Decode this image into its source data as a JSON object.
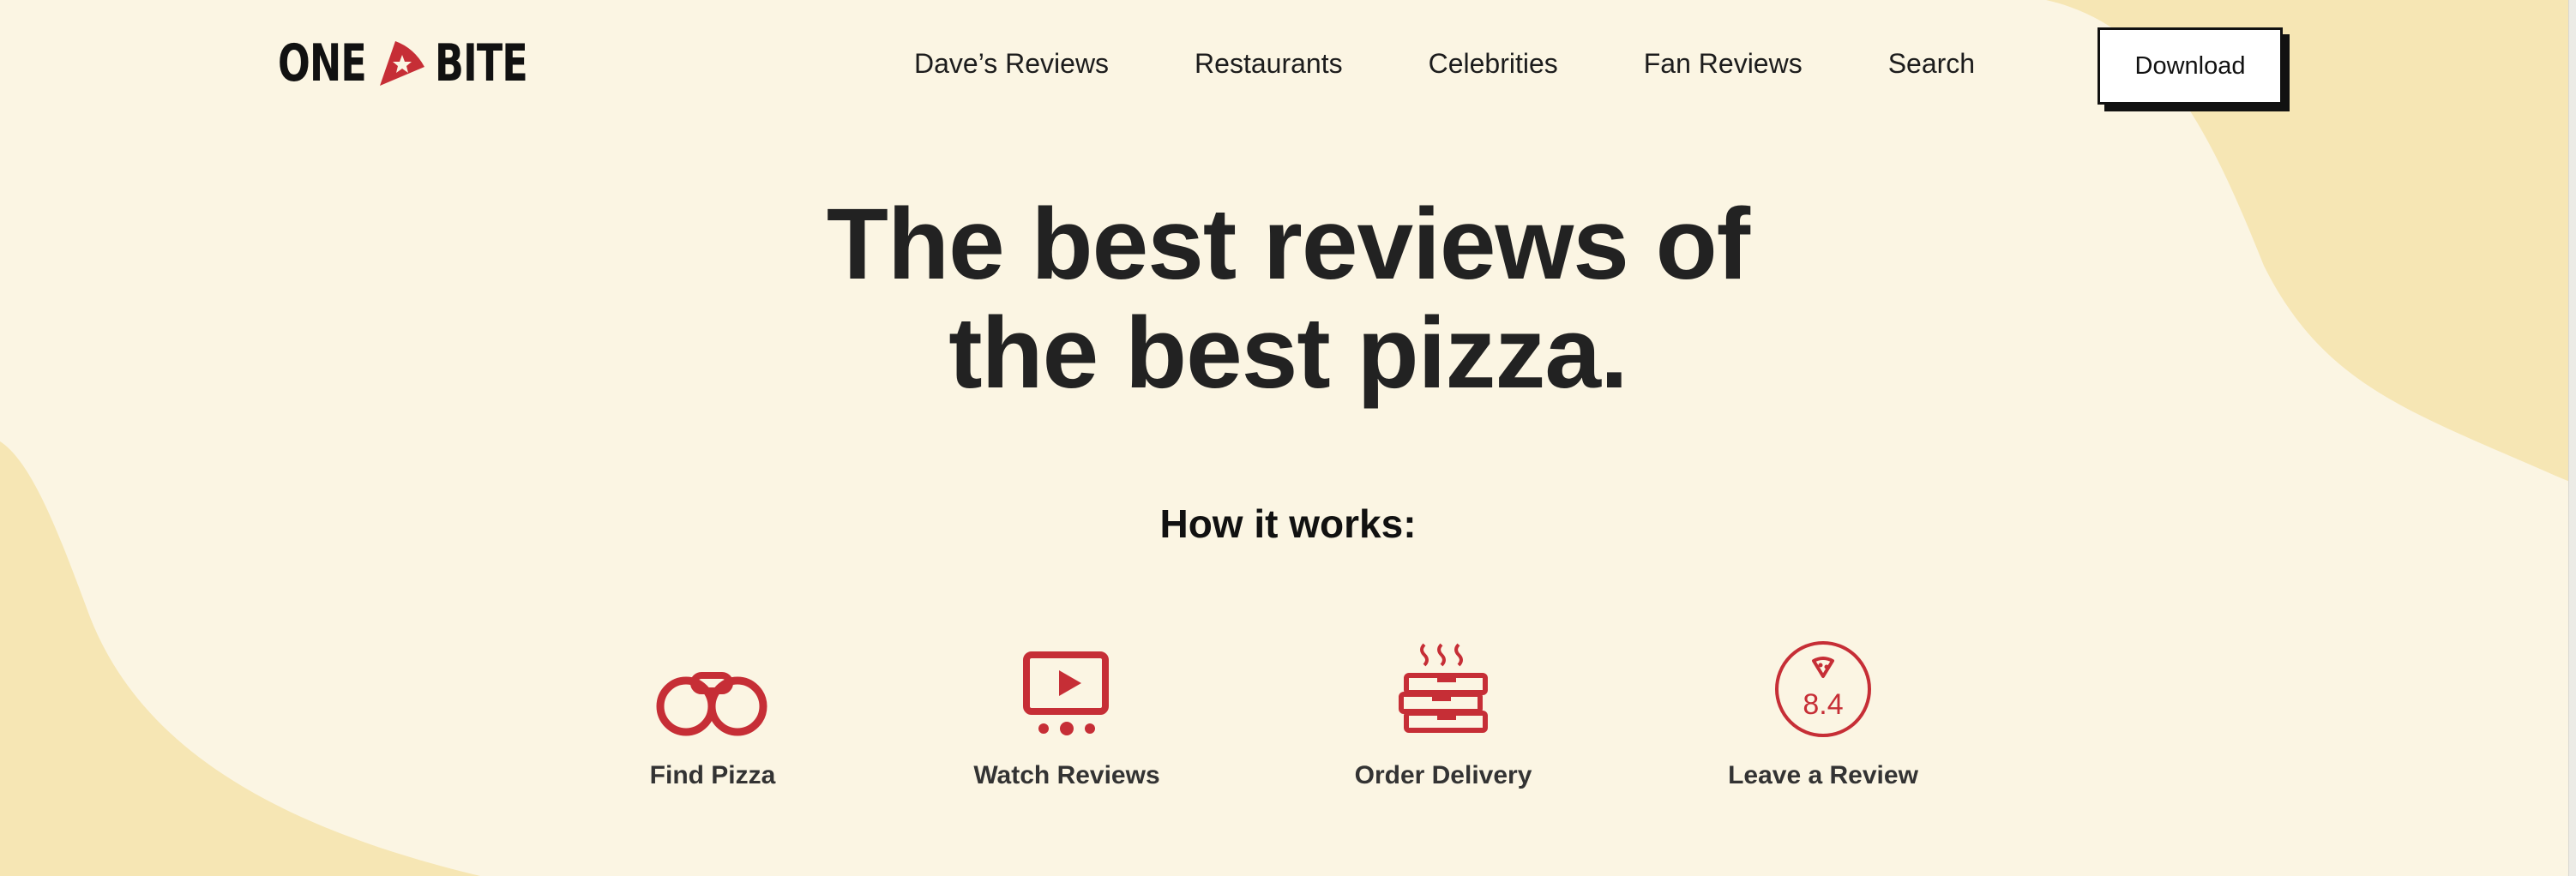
{
  "brand": {
    "logo_left": "ONE",
    "logo_right": "BITE",
    "accent": "#c62e36",
    "background": "#fbf5e3",
    "blob": "#f6e6b4",
    "text": "#222222"
  },
  "nav": {
    "items": [
      {
        "label": "Dave’s Reviews"
      },
      {
        "label": "Restaurants"
      },
      {
        "label": "Celebrities"
      },
      {
        "label": "Fan Reviews"
      },
      {
        "label": "Search"
      }
    ],
    "download_label": "Download"
  },
  "hero": {
    "title_line1": "The best reviews of",
    "title_line2": "the best pizza."
  },
  "how_it_works": {
    "title": "How it works:",
    "steps": [
      {
        "label": "Find Pizza",
        "icon": "binoculars-icon"
      },
      {
        "label": "Watch Reviews",
        "icon": "video-player-icon"
      },
      {
        "label": "Order Delivery",
        "icon": "pizza-boxes-icon"
      },
      {
        "label": "Leave a Review",
        "icon": "review-score-icon",
        "score": "8.4"
      }
    ]
  }
}
